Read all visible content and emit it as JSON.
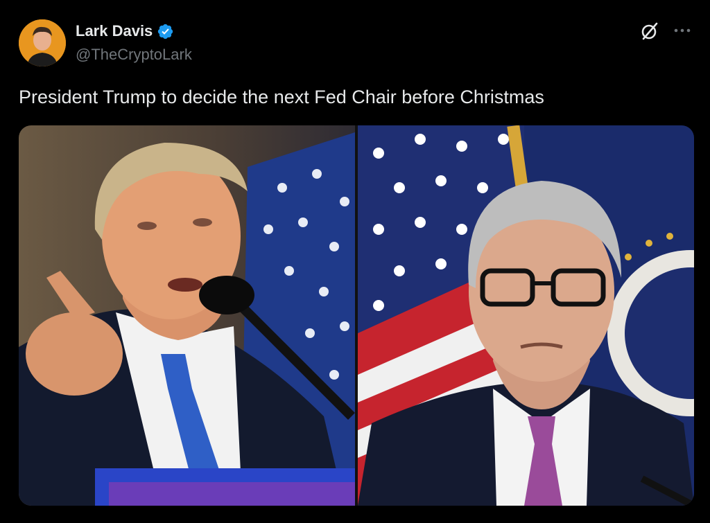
{
  "author": {
    "display_name": "Lark Davis",
    "handle": "@TheCryptoLark",
    "verified": true,
    "verified_color": "#1d9bf0",
    "avatar_bg": "#e8961f"
  },
  "actions": {
    "grok_icon": "grok-slash-circle",
    "more_icon": "ellipsis"
  },
  "tweet": {
    "text": "President Trump to decide the next Fed Chair before Christmas"
  },
  "media": {
    "count": 2,
    "images": [
      {
        "subject": "man speaking at podium with American flag"
      },
      {
        "subject": "man in glasses with American flag and seal"
      }
    ]
  }
}
